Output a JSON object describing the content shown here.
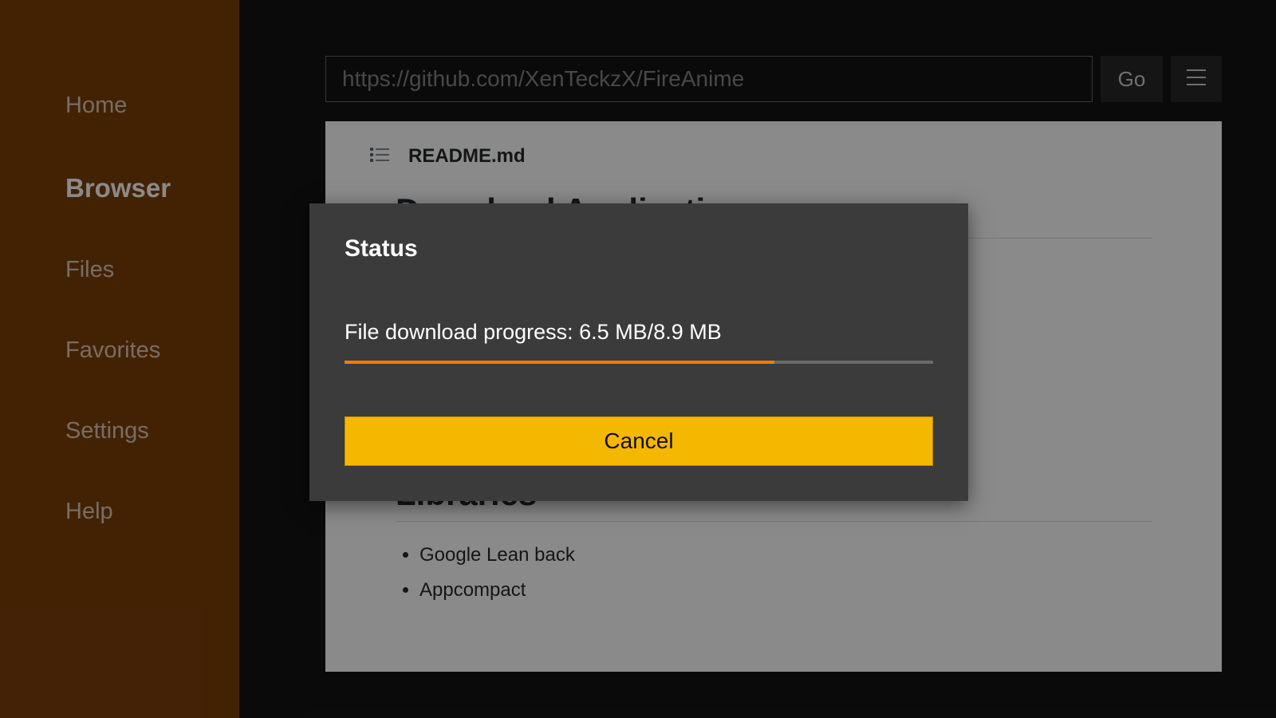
{
  "sidebar": {
    "items": [
      {
        "label": "Home",
        "id": "home"
      },
      {
        "label": "Browser",
        "id": "browser"
      },
      {
        "label": "Files",
        "id": "files"
      },
      {
        "label": "Favorites",
        "id": "favorites"
      },
      {
        "label": "Settings",
        "id": "settings"
      },
      {
        "label": "Help",
        "id": "help"
      }
    ],
    "active_index": 1
  },
  "browser": {
    "url": "https://github.com/XenTeckzX/FireAnime",
    "go_label": "Go"
  },
  "readme": {
    "filename": "README.md",
    "heading_download": "Download Application",
    "heading_libraries": "Libraries",
    "libraries": [
      "Google Lean back",
      "Appcompact"
    ]
  },
  "dialog": {
    "title": "Status",
    "progress_text": "File download progress: 6.5 MB/8.9 MB",
    "downloaded_mb": 6.5,
    "total_mb": 8.9,
    "progress_percent": 73,
    "progress_percent_style": "width:73%",
    "cancel_label": "Cancel"
  }
}
